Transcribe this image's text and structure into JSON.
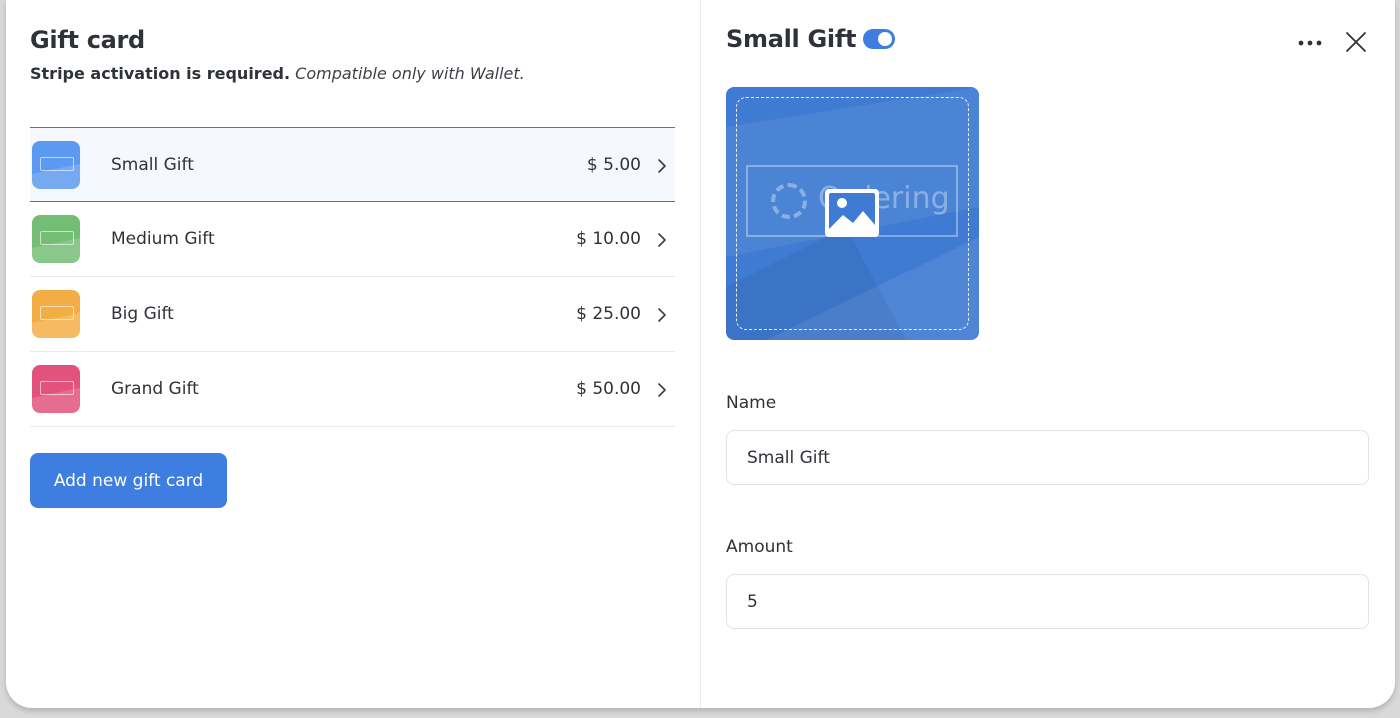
{
  "list_panel": {
    "title": "Gift card",
    "subtitle_strong": "Stripe activation is required.",
    "subtitle_em": "Compatible only with Wallet.",
    "items": [
      {
        "name": "Small Gift",
        "price": "$ 5.00",
        "color": "#5b9af0",
        "selected": true
      },
      {
        "name": "Medium Gift",
        "price": "$ 10.00",
        "color": "#74bd74",
        "selected": false
      },
      {
        "name": "Big Gift",
        "price": "$ 25.00",
        "color": "#f3ad45",
        "selected": false
      },
      {
        "name": "Grand Gift",
        "price": "$ 50.00",
        "color": "#e2527a",
        "selected": false
      }
    ],
    "add_button_label": "Add new gift card"
  },
  "detail_panel": {
    "title": "Small Gift",
    "enabled": true,
    "image_watermark": "Ordering",
    "name_label": "Name",
    "name_value": "Small Gift",
    "amount_label": "Amount",
    "amount_value": "5",
    "more_icon": "more-horizontal-icon",
    "close_icon": "close-icon"
  },
  "colors": {
    "accent": "#3e7ee0",
    "selected_row_border": "#3b73d8",
    "selected_row_bg": "#f5f8fd",
    "image_bg": "#3f7bd2"
  }
}
